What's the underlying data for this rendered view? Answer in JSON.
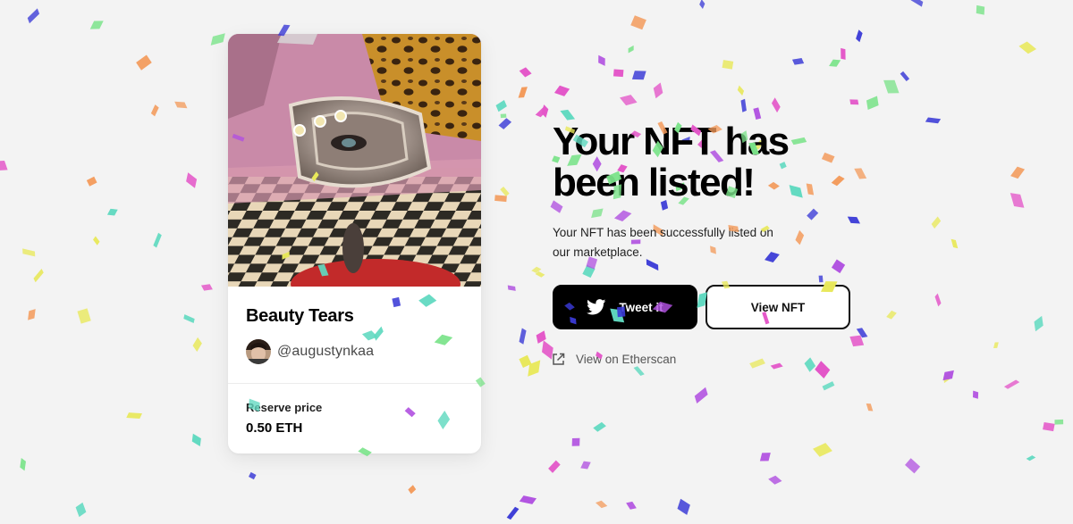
{
  "card": {
    "title": "Beauty Tears",
    "creator_handle": "@augustynkaa",
    "reserve_label": "Reserve price",
    "reserve_value": "0.50 ETH",
    "avatar_icon": "avatar-photo",
    "artwork_icon": "nft-artwork-image"
  },
  "main": {
    "headline": "Your NFT has been listed!",
    "subtext": "Your NFT has been successfully listed on our marketplace.",
    "tweet_label": "Tweet it",
    "view_nft_label": "View NFT",
    "etherscan_label": "View on Etherscan"
  },
  "icons": {
    "tweet": "twitter-bird-icon",
    "etherscan": "external-link-icon"
  },
  "colors": {
    "background": "#f3f3f3",
    "primary_button": "#000000",
    "confetti": [
      "#3a3ad6",
      "#e356c8",
      "#7be38a",
      "#f39a5a",
      "#e8e85a",
      "#60d9c0",
      "#b050e0"
    ]
  }
}
